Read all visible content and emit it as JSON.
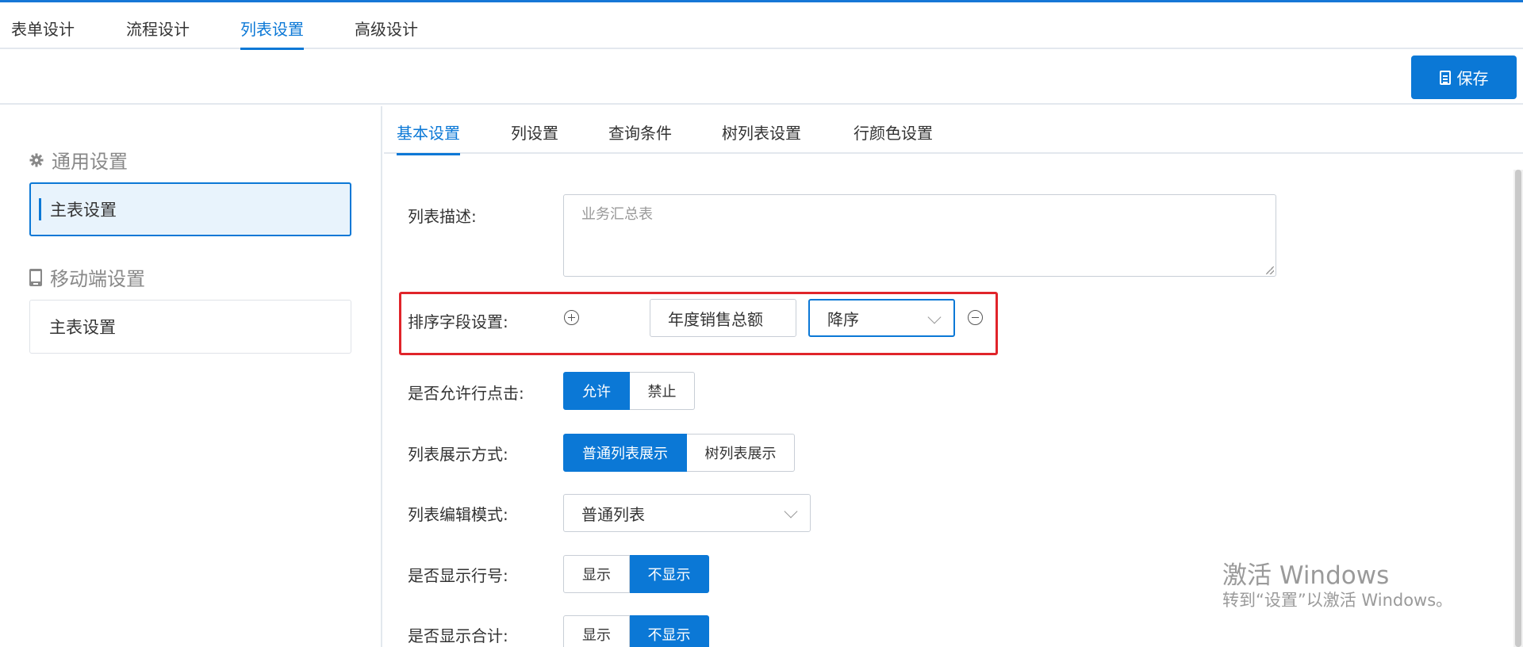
{
  "top_tabs": [
    "表单设计",
    "流程设计",
    "列表设置",
    "高级设计"
  ],
  "toolbar": {
    "save_label": "保存"
  },
  "sidebar": {
    "general_title": "通用设置",
    "general_item": "主表设置",
    "mobile_title": "移动端设置",
    "mobile_item": "主表设置"
  },
  "sub_tabs": [
    "基本设置",
    "列设置",
    "查询条件",
    "树列表设置",
    "行颜色设置"
  ],
  "form": {
    "description": {
      "label": "列表描述:",
      "value": "业务汇总表"
    },
    "sort": {
      "label": "排序字段设置:",
      "field": "年度销售总额",
      "order": "降序"
    },
    "row_click": {
      "label": "是否允许行点击:",
      "options": [
        "允许",
        "禁止"
      ],
      "selected": "允许"
    },
    "display_mode": {
      "label": "列表展示方式:",
      "options": [
        "普通列表展示",
        "树列表展示"
      ],
      "selected": "普通列表展示"
    },
    "edit_mode": {
      "label": "列表编辑模式:",
      "value": "普通列表"
    },
    "row_number": {
      "label": "是否显示行号:",
      "options": [
        "显示",
        "不显示"
      ],
      "selected": "不显示"
    },
    "total": {
      "label": "是否显示合计:",
      "options": [
        "显示",
        "不显示"
      ],
      "selected": "不显示"
    }
  },
  "watermark": {
    "title": "激活 Windows",
    "subtitle": "转到“设置”以激活 Windows。"
  },
  "colors": {
    "accent": "#0b78d6",
    "highlight": "#e0242a"
  }
}
